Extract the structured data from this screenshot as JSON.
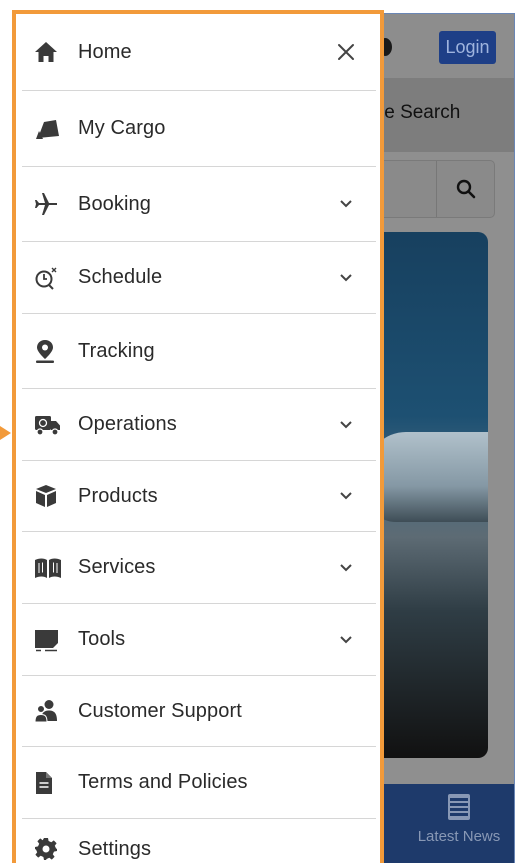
{
  "app": {
    "login_label": "Login",
    "search_tab_label": "le Search",
    "bottom_nav": {
      "news_label": "Latest News"
    }
  },
  "drawer": {
    "items": [
      {
        "label": "Home",
        "icon": "home-icon",
        "trailing": "close-icon"
      },
      {
        "label": "My Cargo",
        "icon": "cargo-icon",
        "trailing": ""
      },
      {
        "label": "Booking",
        "icon": "airplane-icon",
        "trailing": "chevron-down-icon"
      },
      {
        "label": "Schedule",
        "icon": "schedule-icon",
        "trailing": "chevron-down-icon"
      },
      {
        "label": "Tracking",
        "icon": "location-pin-icon",
        "trailing": ""
      },
      {
        "label": "Operations",
        "icon": "truck-icon",
        "trailing": "chevron-down-icon"
      },
      {
        "label": "Products",
        "icon": "package-icon",
        "trailing": "chevron-down-icon"
      },
      {
        "label": "Services",
        "icon": "book-icon",
        "trailing": "chevron-down-icon"
      },
      {
        "label": "Tools",
        "icon": "tools-icon",
        "trailing": "chevron-down-icon"
      },
      {
        "label": "Customer Support",
        "icon": "users-icon",
        "trailing": ""
      },
      {
        "label": "Terms and Policies",
        "icon": "document-icon",
        "trailing": ""
      },
      {
        "label": "Settings",
        "icon": "gear-icon",
        "trailing": ""
      }
    ]
  },
  "colors": {
    "highlight_border": "#f29a3a",
    "login_button": "#1e3f87",
    "bottom_nav": "#1e3a6b"
  }
}
